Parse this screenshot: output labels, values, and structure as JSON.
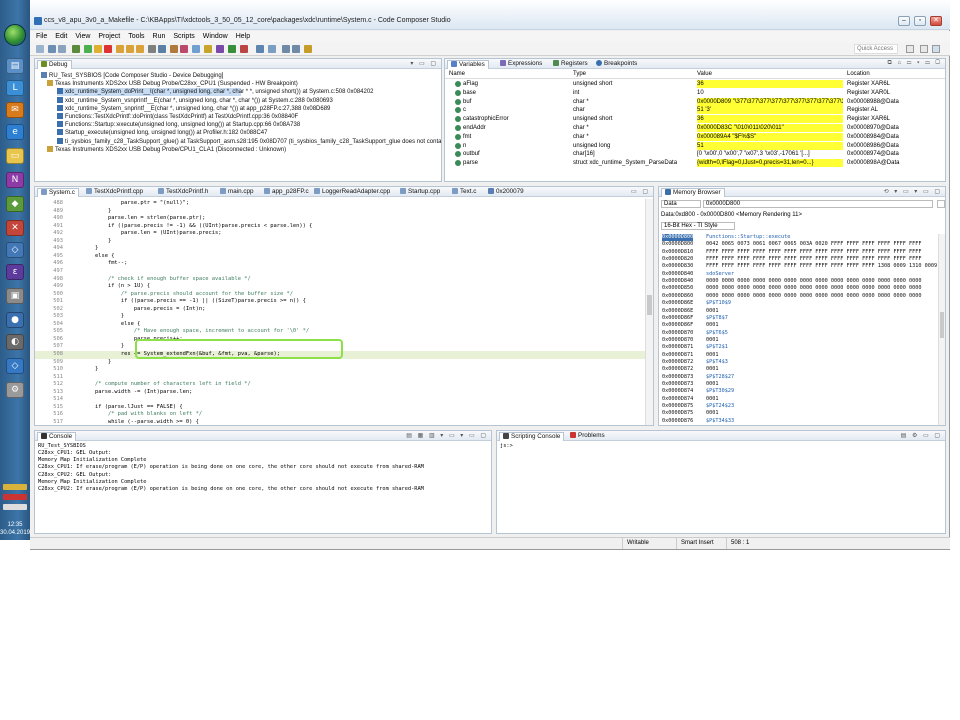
{
  "window": {
    "title": "ccs_v8_apu_3v0_a_Makefile - C:\\KBApps\\TI\\xdctools_3_50_05_12_core\\packages\\xdc\\runtime\\System.c - Code Composer Studio"
  },
  "menu": [
    "File",
    "Edit",
    "View",
    "Project",
    "Tools",
    "Run",
    "Scripts",
    "Window",
    "Help"
  ],
  "toolbar": {
    "quick_access_placeholder": "Quick Access"
  },
  "taskbar": {
    "time": "12:35",
    "date": "30.04.2019"
  },
  "debug": {
    "tab": "Debug",
    "rows": [
      "RU_Test_SYSBIOS [Code Composer Studio - Device Debugging]",
      "Texas Instruments XDS2xx USB Debug Probe/C28xx_CPU1 (Suspended - HW Breakpoint)",
      "xdc_runtime_System_doPrint__I(char *, unsigned long, char *, char * *, unsigned short()) at System.c:508 0x084202",
      "xdc_runtime_System_vsnprintf__E(char *, unsigned long, char *, char *()) at System.c:288 0x080693",
      "xdc_runtime_System_snprintf__E(char *, unsigned long, char *()) at app_p28FP.c:27,388 0x08D689",
      "Functions::TestXdcPrintf::doPrint(class TestXdcPrintf) at TestXdcPrintf.cpp:36 0x08840F",
      "Functions::Startup::execute(unsigned long, unsigned long()) at Startup.cpp:66 0x08A738",
      "Startup_execute(unsigned long, unsigned long()) at Profiler.h:182 0x088C47",
      "ti_sysbios_family_c28_TaskSupport_glue() at TaskSupport_asm.s28:195 0x08D707  (ti_sysbios_family_c28_TaskSupport_glue does not contain fr",
      "Texas Instruments XDS2xx USB Debug Probe/CPU1_CLA1 (Disconnected : Unknown)"
    ]
  },
  "variables": {
    "tabs": [
      "Variables",
      "Expressions",
      "Registers",
      "Breakpoints"
    ],
    "columns": [
      "Name",
      "Type",
      "Value",
      "Location"
    ],
    "rows": [
      {
        "name": "aFlag",
        "type": "unsigned short",
        "value": "36",
        "location": "Register XAR6L",
        "hl": true
      },
      {
        "name": "base",
        "type": "int",
        "value": "10",
        "location": "Register XAR0L",
        "hl": false
      },
      {
        "name": "buf",
        "type": "char *",
        "value": "0x0000D809 \"\\377\\377\\377\\377\\377\\377\\377\\377\\377\\377...",
        "location": "0x00008988@Data",
        "hl": true
      },
      {
        "name": "c",
        "type": "char",
        "value": "51 '3'",
        "location": "Register AL",
        "hl": true
      },
      {
        "name": "catastrophicError",
        "type": "unsigned short",
        "value": "36",
        "location": "Register XAR6L",
        "hl": true
      },
      {
        "name": "endAddr",
        "type": "char *",
        "value": "0x0000D83C \"\\010\\011\\020\\011\"",
        "location": "0x00008970@Data",
        "hl": true
      },
      {
        "name": "fmt",
        "type": "char *",
        "value": "0x000089A4 \"$F%$S\"",
        "location": "0x00008984@Data",
        "hl": true
      },
      {
        "name": "n",
        "type": "unsigned long",
        "value": "51",
        "location": "0x00008986@Data",
        "hl": true
      },
      {
        "name": "outbuf",
        "type": "char[16]",
        "value": "[0 '\\x00',0 '\\x00',7 '\\x07',3 '\\x03',-17061 '[...]",
        "location": "0x00008974@Data",
        "hl": false
      },
      {
        "name": "parse",
        "type": "struct xdc_runtime_System_ParseData",
        "value": "{width=0,lFlag=0,lJust=0,precis=31,len=0...}",
        "location": "0x0000898A@Data",
        "hl": true
      }
    ]
  },
  "editor": {
    "tabs": [
      "System.c",
      "TestXdcPrintf.cpp",
      "TestXdcPrintf.h",
      "main.cpp",
      "app_p28FP.c",
      "LoggerReadAdapter.cpp",
      "Startup.cpp",
      "Text.c",
      "0x200079"
    ],
    "lines": [
      {
        "n": "488",
        "t": "                parse.ptr = \"(null)\";"
      },
      {
        "n": "489",
        "t": "            }"
      },
      {
        "n": "490",
        "t": "            parse.len = strlen(parse.ptr);"
      },
      {
        "n": "491",
        "t": "            if ((parse.precis != -1) && ((UInt)parse.precis < parse.len)) {"
      },
      {
        "n": "492",
        "t": "                parse.len = (UInt)parse.precis;"
      },
      {
        "n": "493",
        "t": "            }"
      },
      {
        "n": "494",
        "t": "        }"
      },
      {
        "n": "495",
        "t": "        else {"
      },
      {
        "n": "496",
        "t": "            fmt--;"
      },
      {
        "n": "497",
        "t": ""
      },
      {
        "n": "498",
        "t": "            /* check if enough buffer space available */"
      },
      {
        "n": "499",
        "t": "            if (n > 1U) {"
      },
      {
        "n": "500",
        "t": "                /* parse.precis should account for the buffer size */"
      },
      {
        "n": "501",
        "t": "                if ((parse.precis == -1) || ((SizeT)parse.precis >= n)) {"
      },
      {
        "n": "502",
        "t": "                    parse.precis = (Int)n;"
      },
      {
        "n": "503",
        "t": "                }"
      },
      {
        "n": "504",
        "t": "                else {"
      },
      {
        "n": "505",
        "t": "                    /* Have enough space, increment to account for '\\0' */"
      },
      {
        "n": "506",
        "t": "                    parse.precis++;"
      },
      {
        "n": "507",
        "t": "                }"
      },
      {
        "n": "508",
        "t": "                res += System_extendFxn(&buf, &fmt, pva, &parse);"
      },
      {
        "n": "509",
        "t": "            }"
      },
      {
        "n": "510",
        "t": "        }"
      },
      {
        "n": "511",
        "t": ""
      },
      {
        "n": "512",
        "t": "        /* compute number of characters left in field */"
      },
      {
        "n": "513",
        "t": "        parse.width -= (Int)parse.len;"
      },
      {
        "n": "514",
        "t": ""
      },
      {
        "n": "515",
        "t": "        if (parse.lJust == FALSE) {"
      },
      {
        "n": "516",
        "t": "            /* pad with blanks on left */"
      },
      {
        "n": "517",
        "t": "            while (--parse.width >= 0) {"
      }
    ]
  },
  "memory": {
    "tab": "Memory Browser",
    "page": "Data",
    "address": "0x0000D800",
    "rendering_label": "Data:0xd800 - 0x0000D800 <Memory Rendering 11>",
    "format": "16-Bit Hex - TI Style",
    "rows": [
      {
        "a": "0x0000D800",
        "d": "Functions::Startup::execute",
        "sym": true
      },
      {
        "a": "0x0000D800",
        "d": "0042 0065 0073 0061 0067 0065 003A 0020 FFFF FFFF FFFF FFFF FFFF FFFF",
        "sym": false
      },
      {
        "a": "0x0000D810",
        "d": "FFFF FFFF FFFF FFFF FFFF FFFF FFFF FFFF FFFF FFFF FFFF FFFF FFFF FFFF",
        "sym": false
      },
      {
        "a": "0x0000D820",
        "d": "FFFF FFFF FFFF FFFF FFFF FFFF FFFF FFFF FFFF FFFF FFFF FFFF FFFF FFFF",
        "sym": false
      },
      {
        "a": "0x0000D830",
        "d": "FFFF FFFF FFFF FFFF FFFF FFFF FFFF FFFF FFFF FFFF FFFF 1308 0009 1310 0009",
        "sym": false
      },
      {
        "a": "0x0000D840",
        "d": "sdoServer",
        "sym": true
      },
      {
        "a": "0x0000D840",
        "d": "0000 0000 0000 0000 0000 0000 0000 0000 0000 0000 0000 0000 0000 0000",
        "sym": false
      },
      {
        "a": "0x0000D850",
        "d": "0000 0000 0000 0000 0000 0000 0000 0000 0000 0000 0000 0000 0000 0000",
        "sym": false
      },
      {
        "a": "0x0000D860",
        "d": "0000 0000 0000 0000 0000 0000 0000 0000 0000 0000 0000 0000 0000 0000",
        "sym": false
      },
      {
        "a": "0x0000D86E",
        "d": "$P$T10$9",
        "sym": true
      },
      {
        "a": "0x0000D86E",
        "d": "0001",
        "sym": false
      },
      {
        "a": "0x0000D86F",
        "d": "$P$T8$7",
        "sym": true
      },
      {
        "a": "0x0000D86F",
        "d": "0001",
        "sym": false
      },
      {
        "a": "0x0000D870",
        "d": "$P$T6$5",
        "sym": true
      },
      {
        "a": "0x0000D870",
        "d": "0001",
        "sym": false
      },
      {
        "a": "0x0000D871",
        "d": "$P$T2$1",
        "sym": true
      },
      {
        "a": "0x0000D871",
        "d": "0001",
        "sym": false
      },
      {
        "a": "0x0000D872",
        "d": "$P$T4$3",
        "sym": true
      },
      {
        "a": "0x0000D872",
        "d": "0001",
        "sym": false
      },
      {
        "a": "0x0000D873",
        "d": "$P$T28$27",
        "sym": true
      },
      {
        "a": "0x0000D873",
        "d": "0001",
        "sym": false
      },
      {
        "a": "0x0000D874",
        "d": "$P$T30$29",
        "sym": true
      },
      {
        "a": "0x0000D874",
        "d": "0001",
        "sym": false
      },
      {
        "a": "0x0000D875",
        "d": "$P$T24$23",
        "sym": true
      },
      {
        "a": "0x0000D875",
        "d": "0001",
        "sym": false
      },
      {
        "a": "0x0000D876",
        "d": "$P$T34$33",
        "sym": true
      }
    ]
  },
  "console": {
    "tab": "Console",
    "session": "RU_Test_SYSBIOS",
    "lines": [
      "C28xx_CPU1: GEL Output:",
      "Memory Map Initialization Complete",
      "C28xx_CPU1: If erase/program (E/P) operation is being done on one core, the other core should not execute from shared-RAM",
      "C28xx_CPU2: GEL Output:",
      "Memory Map Initialization Complete",
      "C28xx_CPU2: If erase/program (E/P) operation is being done on one core, the other core should not execute from shared-RAM"
    ]
  },
  "scripting": {
    "tabs": [
      "Scripting Console",
      "Problems"
    ],
    "prompt": "js:>"
  },
  "status": {
    "mode": "Writable",
    "insert": "Smart Insert",
    "pos": "508 : 1"
  }
}
